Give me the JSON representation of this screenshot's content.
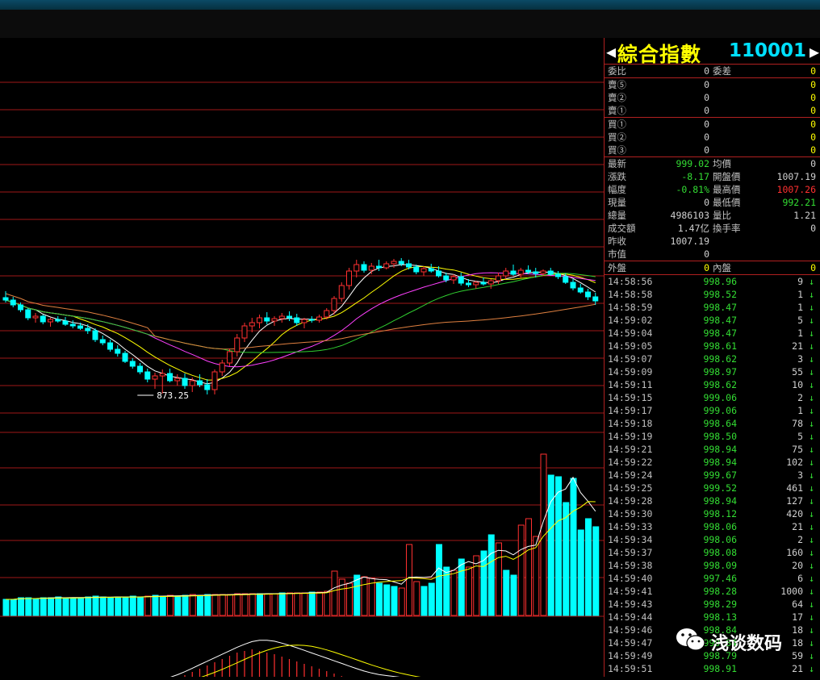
{
  "index": {
    "name": "綜合指數",
    "code": "110001"
  },
  "colors": {
    "up": "#ff3030",
    "down": "#00ffff",
    "grid": "#a01818",
    "text": "#c0c0c0",
    "yellow": "#ffff00",
    "green": "#33dd33"
  },
  "order_book": [
    {
      "label": "委比",
      "value": "0",
      "label2": "委差",
      "value2": "0"
    },
    {
      "label": "賣⑤",
      "value": "0",
      "value2": "0"
    },
    {
      "label": "賣②",
      "value": "0",
      "value2": "0"
    },
    {
      "label": "賣①",
      "value": "0",
      "value2": "0"
    },
    {
      "label": "買①",
      "value": "0",
      "value2": "0"
    },
    {
      "label": "買②",
      "value": "0",
      "value2": "0"
    },
    {
      "label": "買③",
      "value": "0",
      "value2": "0"
    }
  ],
  "stats": [
    {
      "label": "最新",
      "value": "999.02",
      "label2": "均價",
      "value2": "0"
    },
    {
      "label": "漲跌",
      "value": "-8.17",
      "label2": "開盤價",
      "value2": "1007.19"
    },
    {
      "label": "幅度",
      "value": "-0.81%",
      "label2": "最高價",
      "value2": "1007.26"
    },
    {
      "label": "現量",
      "value": "0",
      "label2": "最低價",
      "value2": "992.21"
    },
    {
      "label": "總量",
      "value": "4986103",
      "label2": "量比",
      "value2": "1.21"
    },
    {
      "label": "成交額",
      "value": "1.47亿",
      "label2": "換手率",
      "value2": "0"
    },
    {
      "label": "昨收",
      "value": "1007.19"
    },
    {
      "label": "市值",
      "value": "0"
    }
  ],
  "outer_inner": {
    "label": "外盤",
    "value": "0",
    "label2": "內盤",
    "value2": "0"
  },
  "ticks": [
    {
      "time": "14:58:56",
      "price": "998.96",
      "vol": "9",
      "arrow": "↓"
    },
    {
      "time": "14:58:58",
      "price": "998.52",
      "vol": "1",
      "arrow": "↓"
    },
    {
      "time": "14:58:59",
      "price": "998.47",
      "vol": "1",
      "arrow": "↓"
    },
    {
      "time": "14:59:02",
      "price": "998.47",
      "vol": "5",
      "arrow": "↓"
    },
    {
      "time": "14:59:04",
      "price": "998.47",
      "vol": "1",
      "arrow": "↓"
    },
    {
      "time": "14:59:05",
      "price": "998.61",
      "vol": "21",
      "arrow": "↓"
    },
    {
      "time": "14:59:07",
      "price": "998.62",
      "vol": "3",
      "arrow": "↓"
    },
    {
      "time": "14:59:09",
      "price": "998.97",
      "vol": "55",
      "arrow": "↓"
    },
    {
      "time": "14:59:11",
      "price": "998.62",
      "vol": "10",
      "arrow": "↓"
    },
    {
      "time": "14:59:15",
      "price": "999.06",
      "vol": "2",
      "arrow": "↓"
    },
    {
      "time": "14:59:17",
      "price": "999.06",
      "vol": "1",
      "arrow": "↓"
    },
    {
      "time": "14:59:18",
      "price": "998.64",
      "vol": "78",
      "arrow": "↓"
    },
    {
      "time": "14:59:19",
      "price": "998.50",
      "vol": "5",
      "arrow": "↓"
    },
    {
      "time": "14:59:21",
      "price": "998.94",
      "vol": "75",
      "arrow": "↓"
    },
    {
      "time": "14:59:22",
      "price": "998.94",
      "vol": "102",
      "arrow": "↓"
    },
    {
      "time": "14:59:24",
      "price": "999.67",
      "vol": "3",
      "arrow": "↓"
    },
    {
      "time": "14:59:25",
      "price": "999.52",
      "vol": "461",
      "arrow": "↓"
    },
    {
      "time": "14:59:28",
      "price": "998.94",
      "vol": "127",
      "arrow": "↓"
    },
    {
      "time": "14:59:30",
      "price": "998.12",
      "vol": "420",
      "arrow": "↓"
    },
    {
      "time": "14:59:33",
      "price": "998.06",
      "vol": "21",
      "arrow": "↓"
    },
    {
      "time": "14:59:34",
      "price": "998.06",
      "vol": "2",
      "arrow": "↓"
    },
    {
      "time": "14:59:37",
      "price": "998.08",
      "vol": "160",
      "arrow": "↓"
    },
    {
      "time": "14:59:38",
      "price": "998.09",
      "vol": "20",
      "arrow": "↓"
    },
    {
      "time": "14:59:40",
      "price": "997.46",
      "vol": "6",
      "arrow": "↓"
    },
    {
      "time": "14:59:41",
      "price": "998.28",
      "vol": "1000",
      "arrow": "↓"
    },
    {
      "time": "14:59:43",
      "price": "998.29",
      "vol": "64",
      "arrow": "↓"
    },
    {
      "time": "14:59:44",
      "price": "998.13",
      "vol": "17",
      "arrow": "↓"
    },
    {
      "time": "14:59:46",
      "price": "998.84",
      "vol": "18",
      "arrow": "↓"
    },
    {
      "time": "14:59:47",
      "price": "998.84",
      "vol": "18",
      "arrow": "↓"
    },
    {
      "time": "14:59:49",
      "price": "998.79",
      "vol": "59",
      "arrow": "↓"
    },
    {
      "time": "14:59:51",
      "price": "998.91",
      "vol": "21",
      "arrow": "↓"
    }
  ],
  "chart": {
    "low_label": "873.25",
    "candles": [
      [
        993,
        1001,
        987,
        990
      ],
      [
        990,
        994,
        981,
        984
      ],
      [
        984,
        987,
        975,
        978
      ],
      [
        978,
        980,
        965,
        968
      ],
      [
        968,
        974,
        962,
        970
      ],
      [
        970,
        972,
        960,
        963
      ],
      [
        963,
        968,
        957,
        966
      ],
      [
        966,
        970,
        962,
        964
      ],
      [
        964,
        969,
        958,
        960
      ],
      [
        960,
        965,
        955,
        958
      ],
      [
        958,
        962,
        953,
        955
      ],
      [
        955,
        960,
        948,
        952
      ],
      [
        952,
        955,
        938,
        941
      ],
      [
        941,
        946,
        934,
        937
      ],
      [
        937,
        941,
        926,
        929
      ],
      [
        929,
        934,
        920,
        924
      ],
      [
        924,
        927,
        912,
        914
      ],
      [
        914,
        918,
        905,
        908
      ],
      [
        908,
        912,
        898,
        901
      ],
      [
        901,
        905,
        888,
        892
      ],
      [
        892,
        900,
        880,
        896
      ],
      [
        896,
        904,
        874,
        899
      ],
      [
        899,
        905,
        888,
        890
      ],
      [
        890,
        898,
        884,
        893
      ],
      [
        893,
        899,
        880,
        884
      ],
      [
        884,
        894,
        876,
        890
      ],
      [
        890,
        898,
        882,
        885
      ],
      [
        885,
        892,
        873,
        879
      ],
      [
        879,
        904,
        873,
        901
      ],
      [
        901,
        916,
        896,
        912
      ],
      [
        912,
        930,
        908,
        926
      ],
      [
        926,
        948,
        920,
        943
      ],
      [
        943,
        962,
        938,
        958
      ],
      [
        958,
        968,
        950,
        962
      ],
      [
        962,
        972,
        955,
        968
      ],
      [
        968,
        975,
        960,
        964
      ],
      [
        964,
        970,
        958,
        967
      ],
      [
        967,
        974,
        962,
        970
      ],
      [
        970,
        976,
        964,
        968
      ],
      [
        968,
        973,
        958,
        962
      ],
      [
        962,
        968,
        955,
        966
      ],
      [
        966,
        970,
        962,
        965
      ],
      [
        965,
        972,
        962,
        969
      ],
      [
        969,
        980,
        966,
        977
      ],
      [
        977,
        995,
        972,
        992
      ],
      [
        992,
        1012,
        988,
        1008
      ],
      [
        1008,
        1030,
        1003,
        1026
      ],
      [
        1026,
        1040,
        1018,
        1034
      ],
      [
        1034,
        1038,
        1024,
        1027
      ],
      [
        1027,
        1036,
        1022,
        1032
      ],
      [
        1032,
        1040,
        1026,
        1030
      ],
      [
        1030,
        1038,
        1028,
        1035
      ],
      [
        1035,
        1041,
        1030,
        1038
      ],
      [
        1038,
        1042,
        1032,
        1035
      ],
      [
        1035,
        1040,
        1028,
        1031
      ],
      [
        1031,
        1034,
        1022,
        1025
      ],
      [
        1025,
        1032,
        1020,
        1029
      ],
      [
        1029,
        1035,
        1024,
        1026
      ],
      [
        1026,
        1032,
        1018,
        1020
      ],
      [
        1020,
        1024,
        1012,
        1015
      ],
      [
        1015,
        1022,
        1010,
        1019
      ],
      [
        1019,
        1024,
        1008,
        1011
      ],
      [
        1011,
        1016,
        1006,
        1009
      ],
      [
        1009,
        1014,
        1004,
        1012
      ],
      [
        1012,
        1018,
        1008,
        1010
      ],
      [
        1010,
        1016,
        1004,
        1014
      ],
      [
        1014,
        1024,
        1010,
        1020
      ],
      [
        1020,
        1030,
        1016,
        1026
      ],
      [
        1026,
        1034,
        1020,
        1022
      ],
      [
        1022,
        1030,
        1018,
        1027
      ],
      [
        1027,
        1033,
        1022,
        1025
      ],
      [
        1025,
        1030,
        1018,
        1023
      ],
      [
        1023,
        1028,
        1020,
        1026
      ],
      [
        1026,
        1030,
        1020,
        1022
      ],
      [
        1022,
        1026,
        1016,
        1019
      ],
      [
        1019,
        1023,
        1010,
        1012
      ],
      [
        1012,
        1016,
        1002,
        1005
      ],
      [
        1005,
        1010,
        998,
        1000
      ],
      [
        1000,
        1004,
        990,
        994
      ],
      [
        994,
        999,
        984,
        989
      ]
    ],
    "volumes": [
      [
        20,
        0
      ],
      [
        20,
        0
      ],
      [
        22,
        0
      ],
      [
        22,
        0
      ],
      [
        21,
        0
      ],
      [
        22,
        0
      ],
      [
        22,
        0
      ],
      [
        23,
        0
      ],
      [
        22,
        0
      ],
      [
        22,
        0
      ],
      [
        22,
        0
      ],
      [
        23,
        0
      ],
      [
        24,
        0
      ],
      [
        23,
        0
      ],
      [
        22,
        0
      ],
      [
        23,
        0
      ],
      [
        23,
        0
      ],
      [
        24,
        0
      ],
      [
        23,
        0
      ],
      [
        24,
        1
      ],
      [
        25,
        0
      ],
      [
        24,
        0
      ],
      [
        25,
        1
      ],
      [
        24,
        0
      ],
      [
        25,
        0
      ],
      [
        26,
        1
      ],
      [
        25,
        0
      ],
      [
        26,
        0
      ],
      [
        26,
        1
      ],
      [
        26,
        1
      ],
      [
        26,
        1
      ],
      [
        27,
        1
      ],
      [
        27,
        1
      ],
      [
        27,
        1
      ],
      [
        27,
        0
      ],
      [
        27,
        1
      ],
      [
        27,
        1
      ],
      [
        28,
        0
      ],
      [
        28,
        1
      ],
      [
        28,
        1
      ],
      [
        28,
        1
      ],
      [
        29,
        0
      ],
      [
        29,
        1
      ],
      [
        30,
        1
      ],
      [
        55,
        1
      ],
      [
        45,
        1
      ],
      [
        40,
        1
      ],
      [
        50,
        0
      ],
      [
        48,
        1
      ],
      [
        46,
        1
      ],
      [
        40,
        0
      ],
      [
        38,
        0
      ],
      [
        36,
        0
      ],
      [
        34,
        1
      ],
      [
        88,
        1
      ],
      [
        42,
        1
      ],
      [
        36,
        0
      ],
      [
        40,
        0
      ],
      [
        88,
        0
      ],
      [
        60,
        0
      ],
      [
        56,
        1
      ],
      [
        70,
        0
      ],
      [
        60,
        1
      ],
      [
        74,
        1
      ],
      [
        80,
        0
      ],
      [
        100,
        0
      ],
      [
        90,
        1
      ],
      [
        56,
        0
      ],
      [
        50,
        0
      ],
      [
        112,
        1
      ],
      [
        120,
        1
      ],
      [
        98,
        1
      ],
      [
        200,
        1
      ],
      [
        174,
        0
      ],
      [
        172,
        0
      ],
      [
        140,
        0
      ],
      [
        170,
        0
      ],
      [
        106,
        0
      ],
      [
        120,
        0
      ],
      [
        110,
        0
      ]
    ],
    "macd": [
      -26,
      -25,
      -24,
      -23,
      -22,
      -21,
      -21,
      -20,
      -19,
      -18,
      -18,
      -17,
      -16,
      -15,
      -14,
      -13,
      -11,
      -10,
      -8,
      -6,
      -4,
      -2,
      2,
      6,
      10,
      14,
      18,
      22,
      26,
      30,
      34,
      38,
      40,
      42,
      40,
      38,
      36,
      33,
      30,
      27,
      24,
      21,
      18,
      15,
      12,
      9,
      6,
      3,
      1,
      0,
      -1,
      -2,
      -3,
      -4,
      -5,
      -5,
      -6,
      -6,
      -7,
      -7,
      -7,
      -8,
      -8,
      -8,
      -8,
      -9,
      -9,
      -9,
      -9,
      -9,
      -10,
      -10,
      -10,
      -12,
      -14,
      -16,
      -18,
      -20,
      -22,
      -26
    ]
  }
}
